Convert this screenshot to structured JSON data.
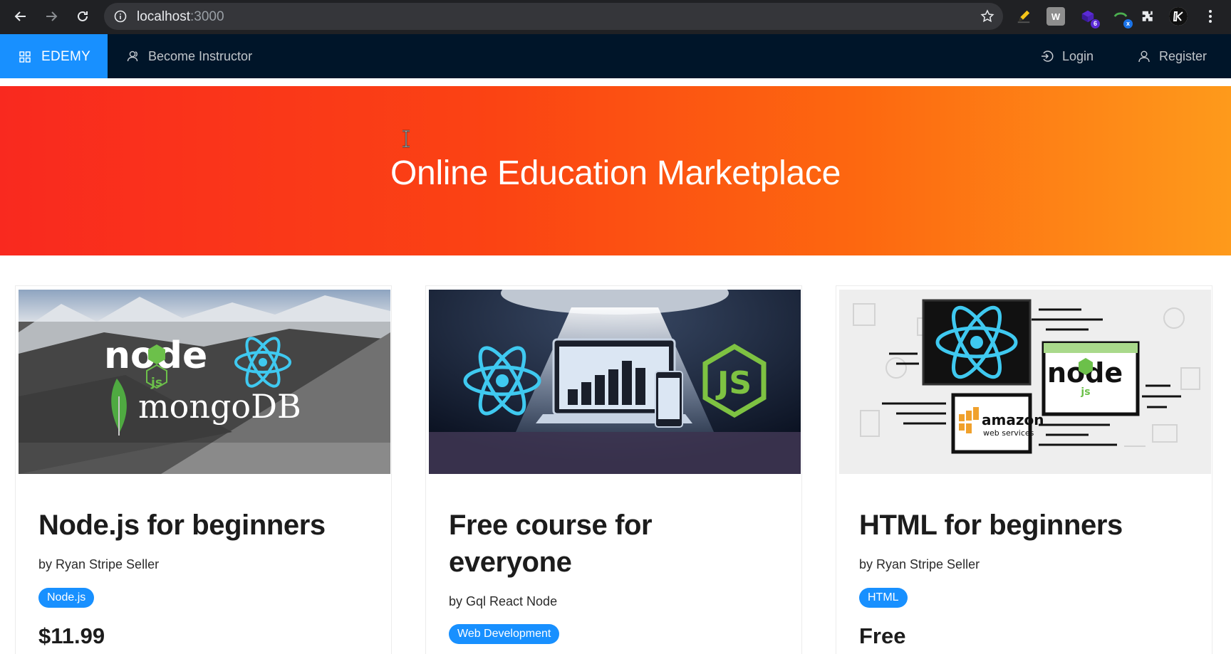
{
  "browser": {
    "url_host": "localhost",
    "url_port": ":3000",
    "extensions": [
      {
        "icon": "pencil-extension-icon"
      },
      {
        "icon": "w-extension-icon",
        "label": "W"
      },
      {
        "icon": "purple-extension-icon",
        "badge": "6"
      },
      {
        "icon": "green-extension-icon",
        "badge": "x"
      },
      {
        "icon": "puzzle-extensions-icon"
      },
      {
        "icon": "profile-avatar-icon"
      }
    ]
  },
  "nav": {
    "brand": "EDEMY",
    "become_instructor": "Become Instructor",
    "login": "Login",
    "register": "Register",
    "brand_color": "#1890ff",
    "bg_color": "#001529"
  },
  "hero": {
    "title": "Online Education Marketplace",
    "gradient": [
      "#f9291f",
      "#fe9a1b"
    ]
  },
  "courses": [
    {
      "title": "Node.js for beginners",
      "author": "by Ryan Stripe Seller",
      "category": "Node.js",
      "price": "$11.99",
      "cover_text": [
        "node",
        "js",
        "mongoDB"
      ]
    },
    {
      "title": "Free course for everyone",
      "author": "by Gql React Node",
      "category": "Web Development",
      "price": "",
      "cover_text": [
        "JS"
      ]
    },
    {
      "title": "HTML for beginners",
      "author": "by Ryan Stripe Seller",
      "category": "HTML",
      "price": "Free",
      "cover_text": [
        "node",
        "js",
        "amazon",
        "web services"
      ]
    }
  ]
}
